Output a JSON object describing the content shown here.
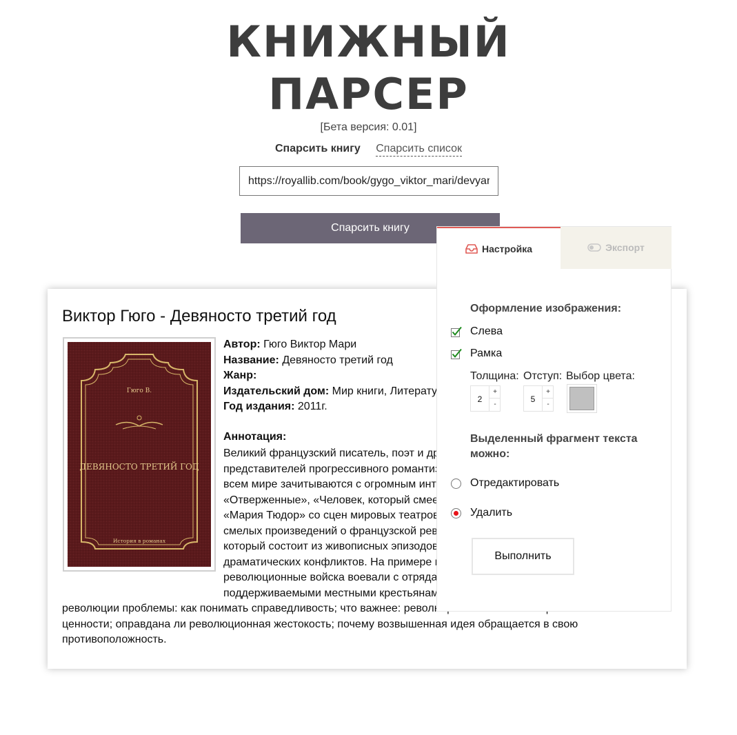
{
  "app": {
    "title_line1": "КНИЖНЫЙ",
    "title_line2": "ПАРСЕР",
    "beta": "[Бета версия: 0.01]"
  },
  "mode_tabs": {
    "parse_book": "Спарсить книгу",
    "parse_list": "Спарсить список"
  },
  "url_input": {
    "value": "https://royallib.com/book/gygo_viktor_mari/devyanosto_tretiy_god.html"
  },
  "parse_button": "Спарсить книгу",
  "book": {
    "heading": "Виктор Гюго - Девяносто третий год",
    "cover": {
      "author": "Гюго В.",
      "title": "ДЕВЯНОСТО ТРЕТИЙ ГОД",
      "series": "История в романах"
    },
    "author_label": "Автор:",
    "author": "Гюго Виктор Мари",
    "name_label": "Название:",
    "name": "Девяносто третий год",
    "genre_label": "Жанр:",
    "genre": "",
    "publisher_label": "Издательский дом:",
    "publisher": "Мир книги, Литература",
    "year_label": "Год издания:",
    "year": "2011г.",
    "annotation_label": "Аннотация:",
    "annotation": "Великий французский писатель, поэт и драматург Виктор Гюго – один из самых ярких представителей прогрессивного романтизма. Его произведения уже более ста лет во всем мире зачитываются с огромным интересом: «Собор Парижской Богоматери», «Отверженные», «Человек, который смеется». Не сходят драмы Гюго «Эрнани», «Мария Тюдор» со сцен мировых театров. Но одно из самых значительных, ярких и смелых произведений о французской революции – роман «Девяносто третий год», который состоит из живописных эпизодов, полных захватывающих приключений и драматических конфликтов. На примере гражданской войны в Вандее, где революционные войска воевали с отрядами монархических мятежников, поддерживаемыми местными крестьянами, Гюго ставит важные для любой революции проблемы: как понимать справедливость; что важнее: революция или вечные общечеловеческие ценности; оправдана ли революционная жестокость; почему возвышенная идея обращается в свою противоположность."
  },
  "panel": {
    "tab_settings": "Настройка",
    "tab_export": "Экспорт",
    "image_heading": "Оформление изображения:",
    "opt_left": "Слева",
    "opt_left_checked": true,
    "opt_frame": "Рамка",
    "opt_frame_checked": true,
    "thickness_label": "Толщина:",
    "thickness_value": "2",
    "indent_label": "Отступ:",
    "indent_value": "5",
    "color_label": "Выбор цвета:",
    "color_value": "#c0c0c0",
    "stepper_plus": "+",
    "stepper_minus": "-",
    "text_heading": "Выделенный фрагмент текста можно:",
    "radio_edit": "Отредактировать",
    "radio_delete": "Удалить",
    "selected_action": "delete",
    "execute_button": "Выполнить"
  },
  "colors": {
    "accent": "#e05a55",
    "button": "#6c6676",
    "cover": "#5a1a1c",
    "cover_gold": "#d8b76a"
  }
}
